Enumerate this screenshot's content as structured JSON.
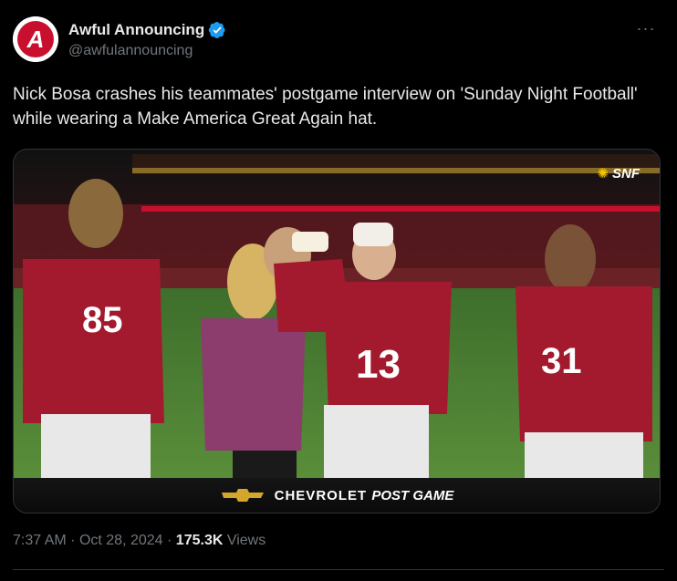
{
  "author": {
    "display_name": "Awful Announcing",
    "handle": "@awfulannouncing",
    "avatar_letter": "A",
    "verified": true,
    "verified_color": "#1d9bf0",
    "brand_color": "#c8102e"
  },
  "more_icon": "more-horizontal-icon",
  "tweet": {
    "text": "Nick Bosa crashes his teammates' postgame interview on 'Sunday Night Football' while wearing a Make America Great Again hat."
  },
  "media": {
    "network_logo": "SNF",
    "banner_sponsor": "CHEVROLET",
    "banner_suffix": "POST GAME",
    "jersey_numbers": [
      "85",
      "13",
      "31"
    ],
    "jersey_color": "#a31a2e"
  },
  "meta": {
    "time": "7:37 AM",
    "separator": "·",
    "date": "Oct 28, 2024",
    "views_count": "175.3K",
    "views_label": "Views"
  }
}
